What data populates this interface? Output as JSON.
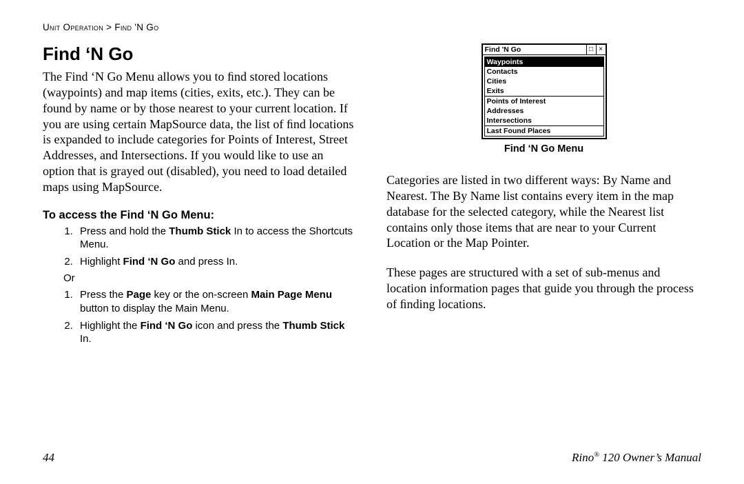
{
  "breadcrumb": "Unit Operation > Find 'N Go",
  "title": "Find ‘N Go",
  "intro": "The Find ‘N Go Menu allows you to ﬁnd stored locations (waypoints) and map items (cities, exits, etc.). They can be found by name or by those nearest to your current location. If you are using certain MapSource data, the list of ﬁnd locations is expanded to include categories for Points of Interest, Street Addresses, and Intersections. If you would like to use an option that is grayed out (disabled), you need to load detailed maps using MapSource.",
  "access_heading": "To access the Find ‘N Go Menu:",
  "stepsA": {
    "s1_pre": "Press and hold the ",
    "s1_b1": "Thumb Stick",
    "s1_post": " In to access the Shortcuts Menu.",
    "s2_pre": "Highlight ",
    "s2_b1": "Find ‘N Go",
    "s2_post": " and press In."
  },
  "or_label": "Or",
  "stepsB": {
    "s1_pre": "Press the ",
    "s1_b1": "Page",
    "s1_mid": " key or the on-screen ",
    "s1_b2": "Main Page Menu",
    "s1_post": " button to display the Main Menu.",
    "s2_pre": "Highlight the ",
    "s2_b1": "Find ‘N Go",
    "s2_mid": " icon and press the ",
    "s2_b2": "Thumb Stick",
    "s2_post": " In."
  },
  "screenshot": {
    "title": "Find 'N Go",
    "close_glyph": "×",
    "min_glyph": "□",
    "items_top": [
      "Waypoints",
      "Contacts",
      "Cities",
      "Exits"
    ],
    "items_mid": [
      "Points of Interest",
      "Addresses",
      "Intersections"
    ],
    "items_bot": [
      "Last Found Places"
    ],
    "caption": "Find ‘N Go Menu"
  },
  "right_para1": "Categories are listed in two different ways: By Name and Nearest. The By Name list contains every item in the map database for the selected category, while the Nearest list contains only those items that are near to your Current Location or the Map Pointer.",
  "right_para2": "These pages are structured with a set of sub-menus and location information pages that guide you through the process of ﬁnding locations.",
  "footer": {
    "page": "44",
    "manual_pre": "Rino",
    "manual_sup": "®",
    "manual_post": " 120 Owner’s Manual"
  }
}
